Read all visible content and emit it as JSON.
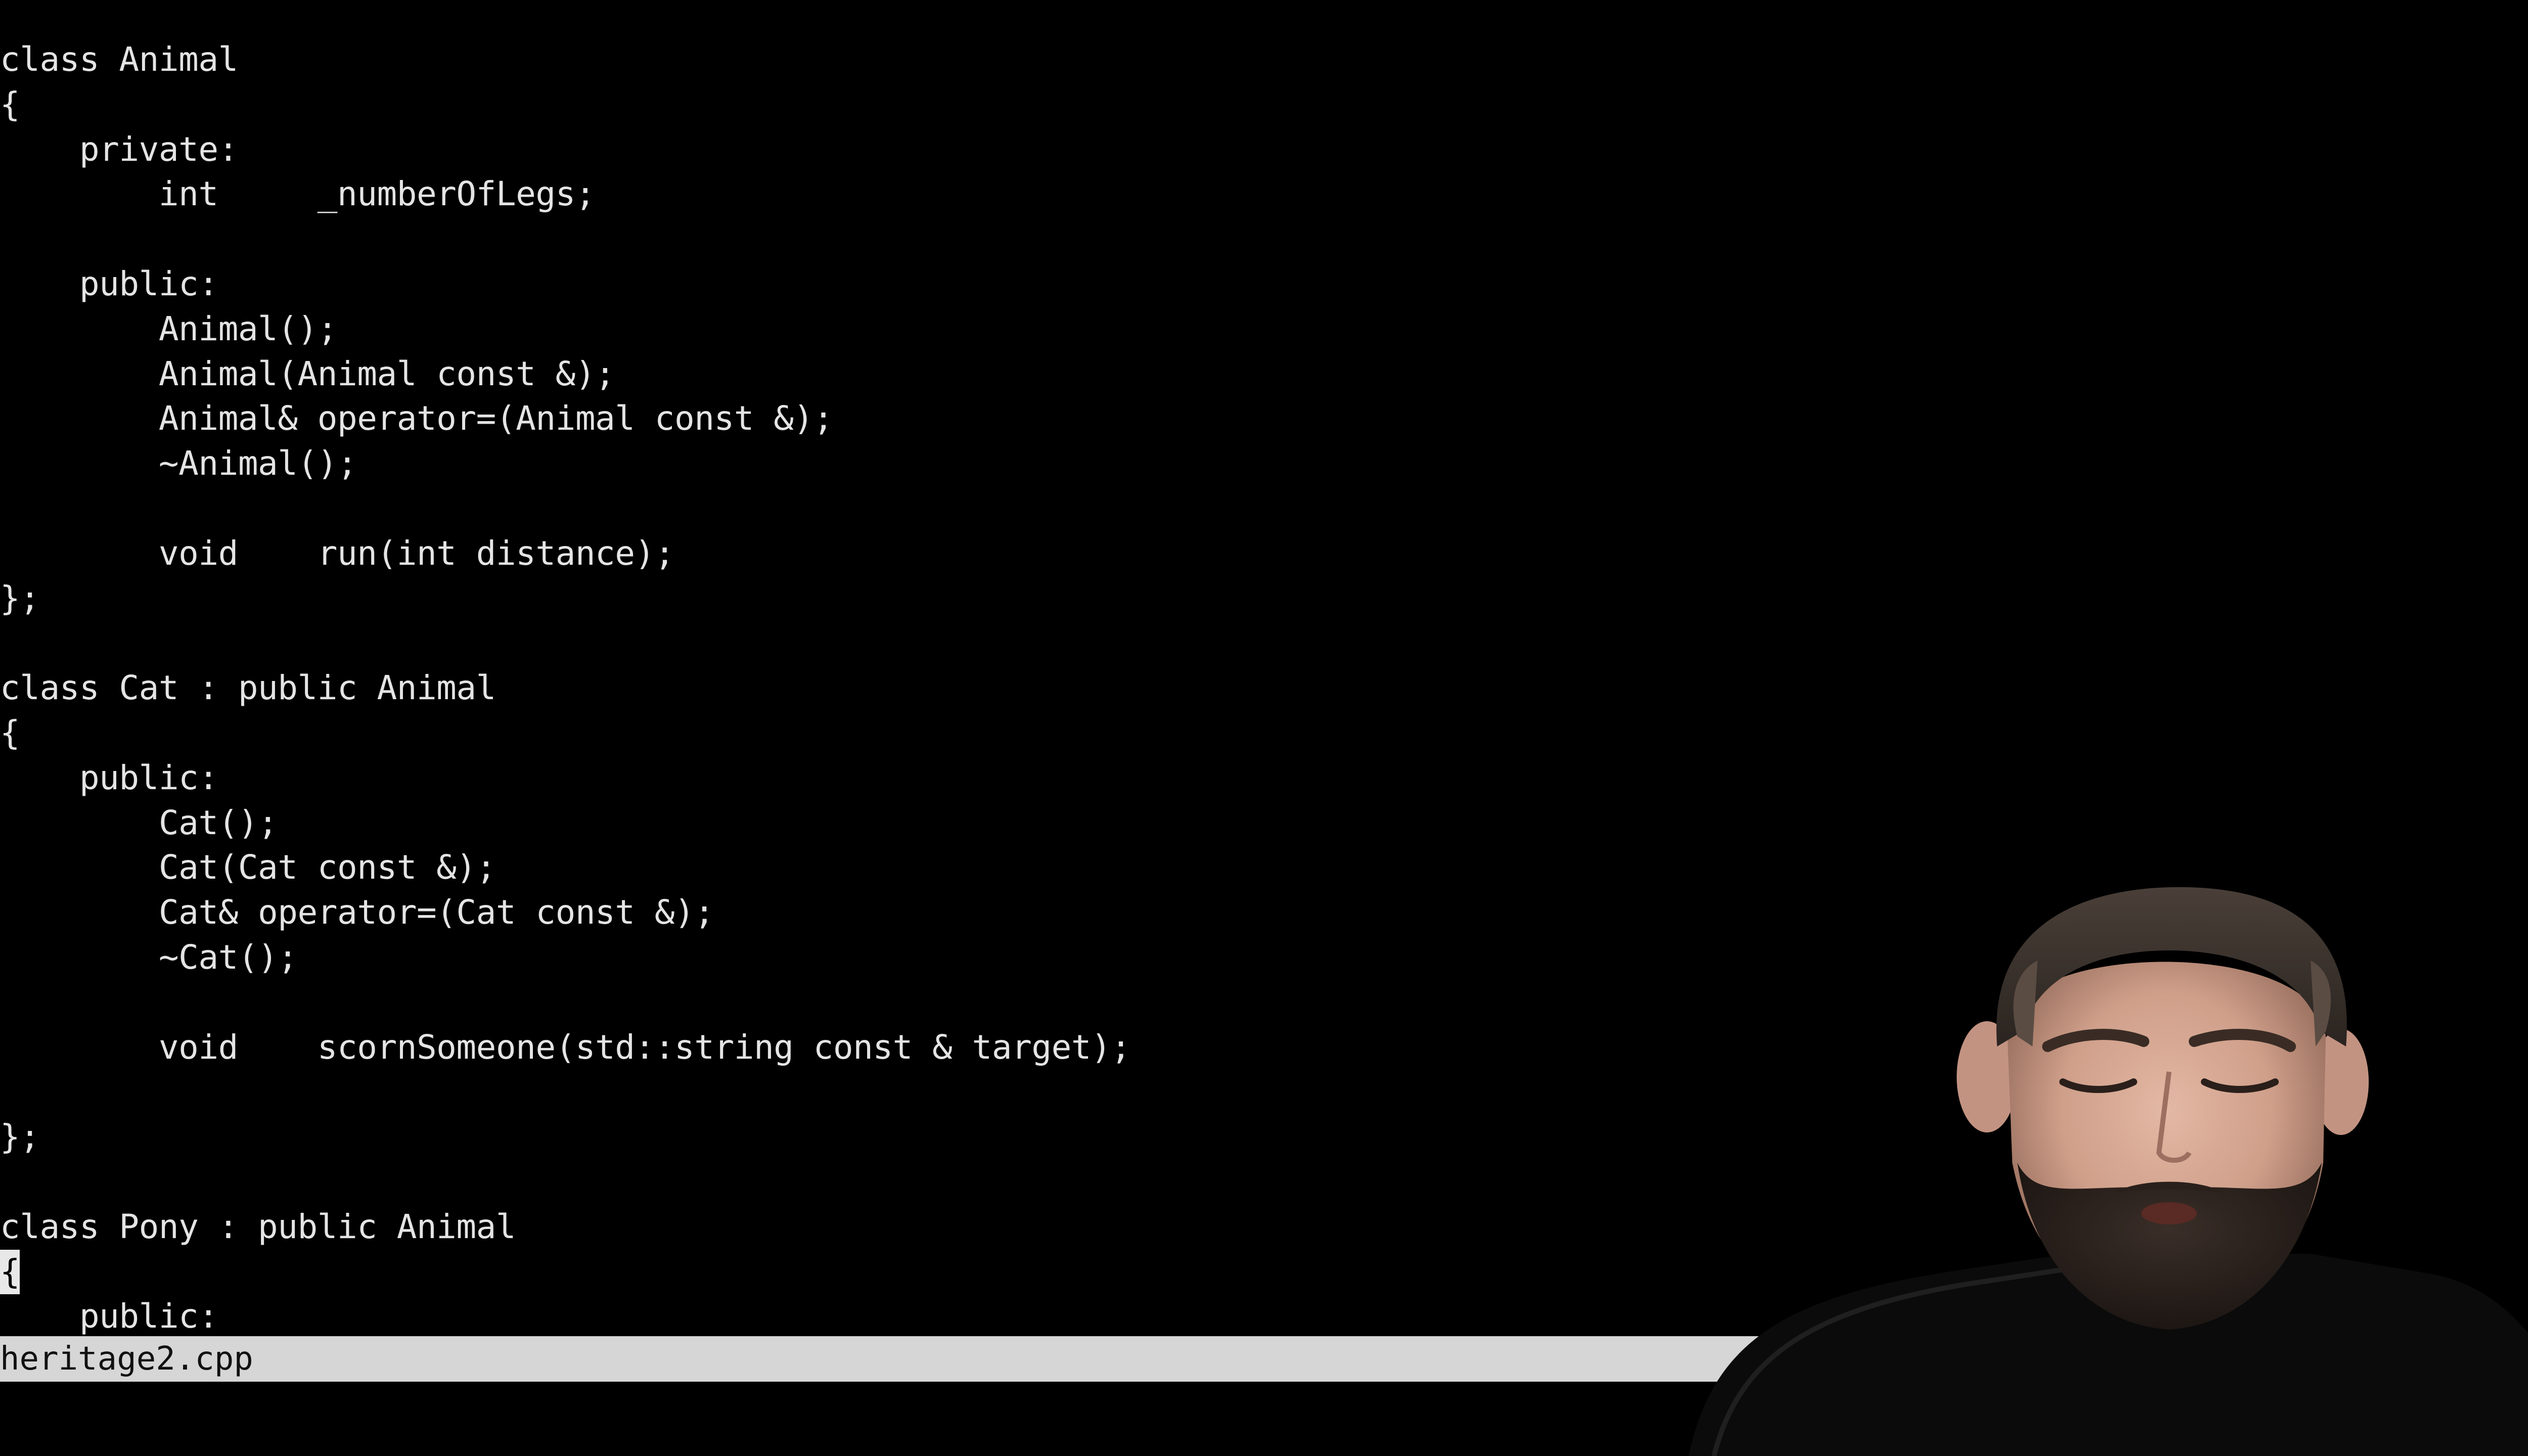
{
  "editor": {
    "lines": [
      "class Animal",
      "{",
      "    private:",
      "        int     _numberOfLegs;",
      "",
      "    public:",
      "        Animal();",
      "        Animal(Animal const &);",
      "        Animal& operator=(Animal const &);",
      "        ~Animal();",
      "",
      "        void    run(int distance);",
      "};",
      "",
      "class Cat : public Animal",
      "{",
      "    public:",
      "        Cat();",
      "        Cat(Cat const &);",
      "        Cat& operator=(Cat const &);",
      "        ~Cat();",
      "",
      "        void    scornSomeone(std::string const & target);",
      "",
      "};",
      "",
      "class Pony : public Animal",
      "{",
      "    public:"
    ],
    "cursor_line": 27,
    "cursor_char": "{"
  },
  "status_bar": {
    "filename": "heritage2.cpp"
  },
  "colors": {
    "background": "#000000",
    "text": "#e4e4e4",
    "status_bar": "#d6d6d6"
  }
}
